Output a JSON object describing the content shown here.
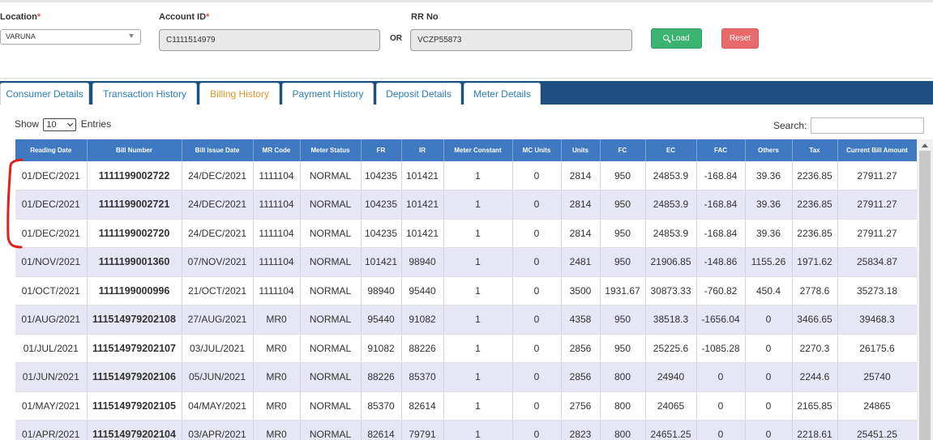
{
  "filters": {
    "location_label": "Location",
    "location_value": "VARUNA",
    "account_label": "Account ID",
    "account_value": "C1111514979",
    "or_label": "OR",
    "rr_label": "RR No",
    "rr_value": "VCZP55873",
    "load_label": "Load",
    "reset_label": "Reset",
    "required_mark": "*"
  },
  "tabs": [
    {
      "label": "Consumer Details",
      "active": false
    },
    {
      "label": "Transaction History",
      "active": false
    },
    {
      "label": "Billing History",
      "active": true
    },
    {
      "label": "Payment History",
      "active": false
    },
    {
      "label": "Deposit Details",
      "active": false
    },
    {
      "label": "Meter Details",
      "active": false
    }
  ],
  "table_controls": {
    "show_label": "Show",
    "entries_value": "10",
    "entries_label": "Entries",
    "search_label": "Search:"
  },
  "table": {
    "headers": [
      "Reading Date",
      "Bill Number",
      "Bill Issue Date",
      "MR Code",
      "Meter Status",
      "FR",
      "IR",
      "Meter Constant",
      "MC Units",
      "Units",
      "FC",
      "EC",
      "FAC",
      "Others",
      "Tax",
      "Current Bill Amount"
    ],
    "rows": [
      [
        "01/DEC/2021",
        "1111199002722",
        "24/DEC/2021",
        "1111104",
        "NORMAL",
        "104235",
        "101421",
        "1",
        "0",
        "2814",
        "950",
        "24853.9",
        "-168.84",
        "39.36",
        "2236.85",
        "27911.27"
      ],
      [
        "01/DEC/2021",
        "1111199002721",
        "24/DEC/2021",
        "1111104",
        "NORMAL",
        "104235",
        "101421",
        "1",
        "0",
        "2814",
        "950",
        "24853.9",
        "-168.84",
        "39.36",
        "2236.85",
        "27911.27"
      ],
      [
        "01/DEC/2021",
        "1111199002720",
        "24/DEC/2021",
        "1111104",
        "NORMAL",
        "104235",
        "101421",
        "1",
        "0",
        "2814",
        "950",
        "24853.9",
        "-168.84",
        "39.36",
        "2236.85",
        "27911.27"
      ],
      [
        "01/NOV/2021",
        "1111199001360",
        "07/NOV/2021",
        "1111104",
        "NORMAL",
        "101421",
        "98940",
        "1",
        "0",
        "2481",
        "950",
        "21906.85",
        "-148.86",
        "1155.26",
        "1971.62",
        "25834.87"
      ],
      [
        "01/OCT/2021",
        "1111199000996",
        "21/OCT/2021",
        "1111104",
        "NORMAL",
        "98940",
        "95440",
        "1",
        "0",
        "3500",
        "1931.67",
        "30873.33",
        "-760.82",
        "450.4",
        "2778.6",
        "35273.18"
      ],
      [
        "01/AUG/2021",
        "111514979202108",
        "27/AUG/2021",
        "MR0",
        "NORMAL",
        "95440",
        "91082",
        "1",
        "0",
        "4358",
        "950",
        "38518.3",
        "-1656.04",
        "0",
        "3466.65",
        "39468.3"
      ],
      [
        "01/JUL/2021",
        "111514979202107",
        "03/JUL/2021",
        "MR0",
        "NORMAL",
        "91082",
        "88226",
        "1",
        "0",
        "2856",
        "950",
        "25225.6",
        "-1085.28",
        "0",
        "2270.3",
        "26175.6"
      ],
      [
        "01/JUN/2021",
        "111514979202106",
        "05/JUN/2021",
        "MR0",
        "NORMAL",
        "88226",
        "85370",
        "1",
        "0",
        "2856",
        "800",
        "24940",
        "0",
        "0",
        "2244.6",
        "25740"
      ],
      [
        "01/MAY/2021",
        "111514979202105",
        "04/MAY/2021",
        "MR0",
        "NORMAL",
        "85370",
        "82614",
        "1",
        "0",
        "2756",
        "800",
        "24065",
        "0",
        "0",
        "2165.85",
        "24865"
      ],
      [
        "01/APR/2021",
        "111514979202104",
        "03/APR/2021",
        "MR0",
        "NORMAL",
        "82614",
        "79791",
        "1",
        "0",
        "2823",
        "800",
        "24651.25",
        "0",
        "0",
        "2218.61",
        "25451.25"
      ]
    ]
  },
  "colors": {
    "tabbar": "#1d4f80",
    "header": "#3e79c2",
    "active_tab": "#e09626",
    "load": "#3cb371",
    "reset": "#e86a6a",
    "annotation": "#e0201c"
  }
}
